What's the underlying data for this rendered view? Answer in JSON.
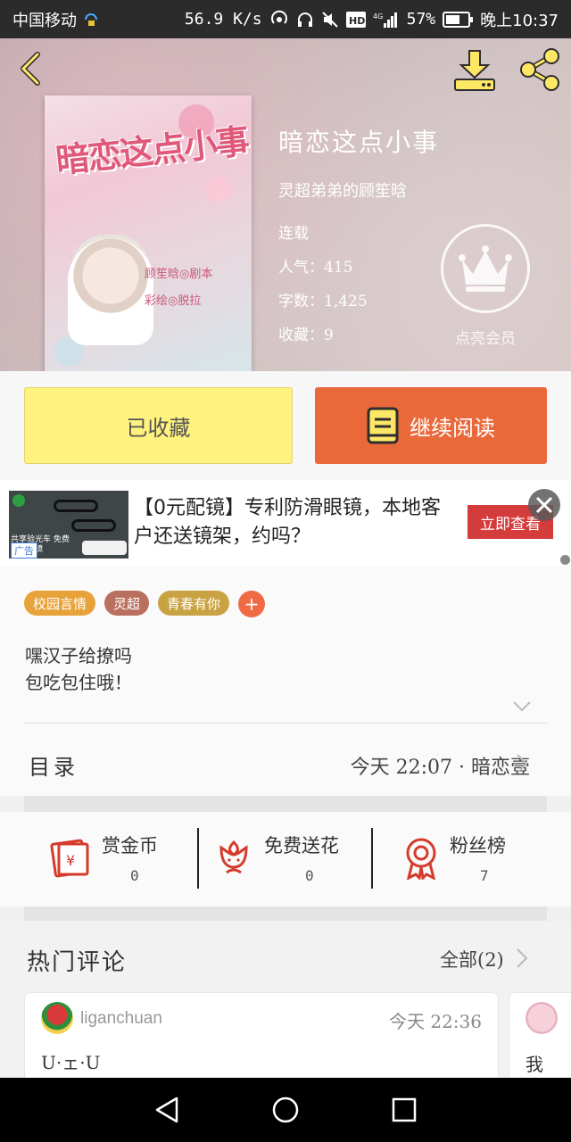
{
  "status_bar": {
    "carrier": "中国移动",
    "speed": "56.9 K/s",
    "battery": "57%",
    "time": "晚上10:37"
  },
  "book": {
    "title": "暗恋这点小事",
    "author": "灵超弟弟的顾笙晗",
    "status": "连载",
    "popularity": "人气：415",
    "word_count": "字数：1,425",
    "favorites": "收藏：9",
    "vip_label": "点亮会员"
  },
  "cover": {
    "title_text": "暗恋这点小事",
    "credit_line1": "顾笙晗◎剧本",
    "credit_line2": "彩绘◎脱拉"
  },
  "actions": {
    "collected_label": "已收藏",
    "read_label": "继续阅读"
  },
  "ad": {
    "text": "【0元配镜】专利防滑眼镜，本地客户还送镜架，约吗？",
    "cta": "立即查看",
    "badge": "广告",
    "image_caption": "共享验光车 免费上门配镜"
  },
  "tags": [
    {
      "label": "校园言情",
      "color": "#e8a23a"
    },
    {
      "label": "灵超",
      "color": "#b9705e"
    },
    {
      "label": "青春有你",
      "color": "#c9a343"
    }
  ],
  "tag_add": "+",
  "intro": {
    "line1": "嘿汉子给撩吗",
    "line2": "包吃包住哦！"
  },
  "toc": {
    "label": "目录",
    "latest": "今天 22:07 · 暗恋壹"
  },
  "stats": [
    {
      "label": "赏金币",
      "value": "0"
    },
    {
      "label": "免费送花",
      "value": "0"
    },
    {
      "label": "粉丝榜",
      "value": "7"
    }
  ],
  "comments": {
    "title": "热门评论",
    "all": "全部(2)",
    "items": [
      {
        "user": "liganchuan",
        "time": "今天 22:36",
        "text": "U·ェ·U"
      },
      {
        "text": "我"
      }
    ]
  },
  "colors": {
    "accent_orange": "#e9693a",
    "collected_yellow": "#fff27e",
    "icon_red": "#d43b2c"
  }
}
